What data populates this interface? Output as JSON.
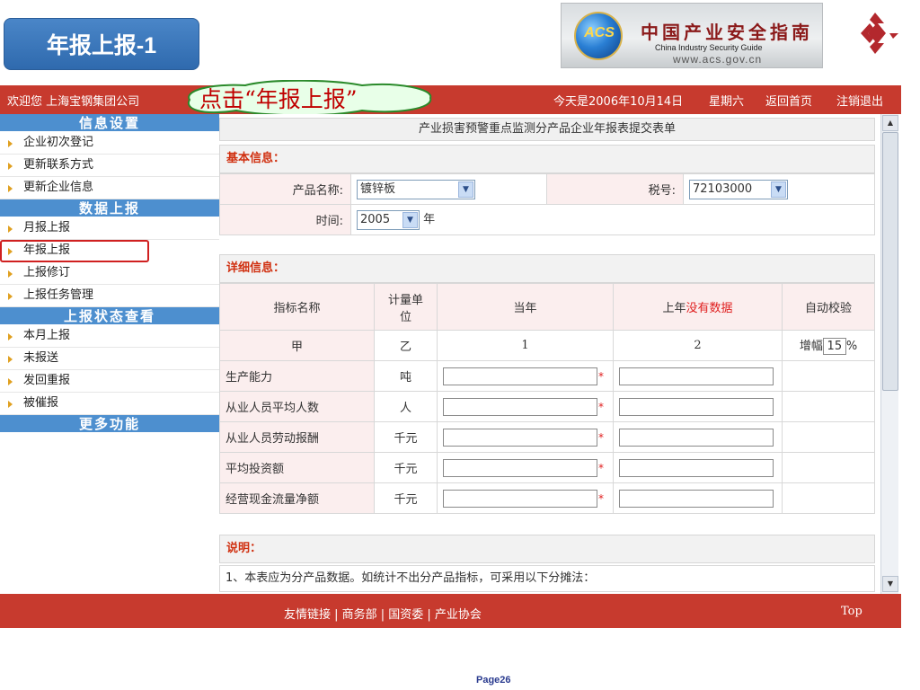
{
  "slide": {
    "title": "年报上报-1",
    "page": "Page26"
  },
  "banner": {
    "acs": "ACS",
    "cn": "中国产业安全指南",
    "en": "China Industry Security Guide",
    "url": "www.acs.gov.cn"
  },
  "topbar": {
    "welcome": "欢迎您 上海宝钢集团公司",
    "callout": "点击“年报上报”",
    "date": "今天是2006年10月14日",
    "weekday": "星期六",
    "home": "返回首页",
    "logout": "注销退出"
  },
  "sidebar": {
    "sections": [
      {
        "title": "信息设置",
        "items": [
          "企业初次登记",
          "更新联系方式",
          "更新企业信息"
        ]
      },
      {
        "title": "数据上报",
        "items": [
          "月报上报",
          "年报上报",
          "上报修订",
          "上报任务管理"
        ]
      },
      {
        "title": "上报状态查看",
        "items": [
          "本月上报",
          "未报送",
          "发回重报",
          "被催报"
        ]
      },
      {
        "title": "更多功能",
        "items": []
      }
    ],
    "selected": "年报上报"
  },
  "form": {
    "title": "产业损害预警重点监测分产品企业年报表提交表单",
    "basic_header": "基本信息：",
    "product_label": "产品名称:",
    "product_value": "镀锌板",
    "tax_label": "税号:",
    "tax_value": "72103000",
    "time_label": "时间:",
    "year_value": "2005",
    "year_unit": "年",
    "detail_header": "详细信息：",
    "columns": {
      "name": "指标名称",
      "unit": "计量单位",
      "current": "当年",
      "prev_prefix": "上年",
      "prev_nodata": "没有数据",
      "check": "自动校验"
    },
    "code_row": {
      "name": "甲",
      "unit": "乙",
      "current": "1",
      "prev": "2",
      "check_prefix": "增幅",
      "check_value": "15",
      "check_suffix": "%"
    },
    "rows": [
      {
        "name": "生产能力",
        "unit": "吨"
      },
      {
        "name": "从业人员平均人数",
        "unit": "人"
      },
      {
        "name": "从业人员劳动报酬",
        "unit": "千元"
      },
      {
        "name": "平均投资额",
        "unit": "千元"
      },
      {
        "name": "经营现金流量净额",
        "unit": "千元"
      }
    ],
    "required_mark": "*",
    "note_header": "说明：",
    "note_text": "1、本表应为分产品数据。如统计不出分产品指标，可采用以下分摊法："
  },
  "footer": {
    "links": "友情链接 | 商务部 | 国资委 | 产业协会",
    "top": "Top"
  },
  "colors": {
    "bar_red": "#c73a2e",
    "sidebar_blue": "#4d8fcf",
    "label_pink": "#fbeeee",
    "section_red": "#d03010"
  }
}
